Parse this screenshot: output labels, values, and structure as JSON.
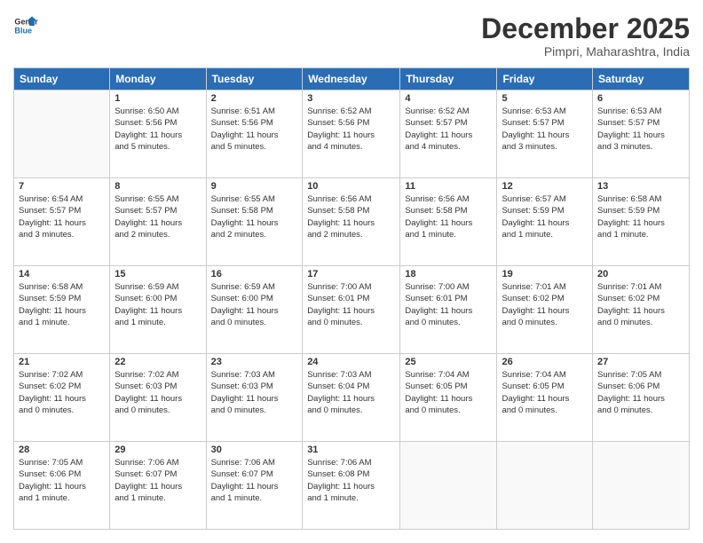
{
  "logo": {
    "general": "General",
    "blue": "Blue"
  },
  "title": "December 2025",
  "subtitle": "Pimpri, Maharashtra, India",
  "days_of_week": [
    "Sunday",
    "Monday",
    "Tuesday",
    "Wednesday",
    "Thursday",
    "Friday",
    "Saturday"
  ],
  "weeks": [
    [
      {
        "day": "",
        "info": ""
      },
      {
        "day": "1",
        "info": "Sunrise: 6:50 AM\nSunset: 5:56 PM\nDaylight: 11 hours\nand 5 minutes."
      },
      {
        "day": "2",
        "info": "Sunrise: 6:51 AM\nSunset: 5:56 PM\nDaylight: 11 hours\nand 5 minutes."
      },
      {
        "day": "3",
        "info": "Sunrise: 6:52 AM\nSunset: 5:56 PM\nDaylight: 11 hours\nand 4 minutes."
      },
      {
        "day": "4",
        "info": "Sunrise: 6:52 AM\nSunset: 5:57 PM\nDaylight: 11 hours\nand 4 minutes."
      },
      {
        "day": "5",
        "info": "Sunrise: 6:53 AM\nSunset: 5:57 PM\nDaylight: 11 hours\nand 3 minutes."
      },
      {
        "day": "6",
        "info": "Sunrise: 6:53 AM\nSunset: 5:57 PM\nDaylight: 11 hours\nand 3 minutes."
      }
    ],
    [
      {
        "day": "7",
        "info": "Sunrise: 6:54 AM\nSunset: 5:57 PM\nDaylight: 11 hours\nand 3 minutes."
      },
      {
        "day": "8",
        "info": "Sunrise: 6:55 AM\nSunset: 5:57 PM\nDaylight: 11 hours\nand 2 minutes."
      },
      {
        "day": "9",
        "info": "Sunrise: 6:55 AM\nSunset: 5:58 PM\nDaylight: 11 hours\nand 2 minutes."
      },
      {
        "day": "10",
        "info": "Sunrise: 6:56 AM\nSunset: 5:58 PM\nDaylight: 11 hours\nand 2 minutes."
      },
      {
        "day": "11",
        "info": "Sunrise: 6:56 AM\nSunset: 5:58 PM\nDaylight: 11 hours\nand 1 minute."
      },
      {
        "day": "12",
        "info": "Sunrise: 6:57 AM\nSunset: 5:59 PM\nDaylight: 11 hours\nand 1 minute."
      },
      {
        "day": "13",
        "info": "Sunrise: 6:58 AM\nSunset: 5:59 PM\nDaylight: 11 hours\nand 1 minute."
      }
    ],
    [
      {
        "day": "14",
        "info": "Sunrise: 6:58 AM\nSunset: 5:59 PM\nDaylight: 11 hours\nand 1 minute."
      },
      {
        "day": "15",
        "info": "Sunrise: 6:59 AM\nSunset: 6:00 PM\nDaylight: 11 hours\nand 1 minute."
      },
      {
        "day": "16",
        "info": "Sunrise: 6:59 AM\nSunset: 6:00 PM\nDaylight: 11 hours\nand 0 minutes."
      },
      {
        "day": "17",
        "info": "Sunrise: 7:00 AM\nSunset: 6:01 PM\nDaylight: 11 hours\nand 0 minutes."
      },
      {
        "day": "18",
        "info": "Sunrise: 7:00 AM\nSunset: 6:01 PM\nDaylight: 11 hours\nand 0 minutes."
      },
      {
        "day": "19",
        "info": "Sunrise: 7:01 AM\nSunset: 6:02 PM\nDaylight: 11 hours\nand 0 minutes."
      },
      {
        "day": "20",
        "info": "Sunrise: 7:01 AM\nSunset: 6:02 PM\nDaylight: 11 hours\nand 0 minutes."
      }
    ],
    [
      {
        "day": "21",
        "info": "Sunrise: 7:02 AM\nSunset: 6:02 PM\nDaylight: 11 hours\nand 0 minutes."
      },
      {
        "day": "22",
        "info": "Sunrise: 7:02 AM\nSunset: 6:03 PM\nDaylight: 11 hours\nand 0 minutes."
      },
      {
        "day": "23",
        "info": "Sunrise: 7:03 AM\nSunset: 6:03 PM\nDaylight: 11 hours\nand 0 minutes."
      },
      {
        "day": "24",
        "info": "Sunrise: 7:03 AM\nSunset: 6:04 PM\nDaylight: 11 hours\nand 0 minutes."
      },
      {
        "day": "25",
        "info": "Sunrise: 7:04 AM\nSunset: 6:05 PM\nDaylight: 11 hours\nand 0 minutes."
      },
      {
        "day": "26",
        "info": "Sunrise: 7:04 AM\nSunset: 6:05 PM\nDaylight: 11 hours\nand 0 minutes."
      },
      {
        "day": "27",
        "info": "Sunrise: 7:05 AM\nSunset: 6:06 PM\nDaylight: 11 hours\nand 0 minutes."
      }
    ],
    [
      {
        "day": "28",
        "info": "Sunrise: 7:05 AM\nSunset: 6:06 PM\nDaylight: 11 hours\nand 1 minute."
      },
      {
        "day": "29",
        "info": "Sunrise: 7:06 AM\nSunset: 6:07 PM\nDaylight: 11 hours\nand 1 minute."
      },
      {
        "day": "30",
        "info": "Sunrise: 7:06 AM\nSunset: 6:07 PM\nDaylight: 11 hours\nand 1 minute."
      },
      {
        "day": "31",
        "info": "Sunrise: 7:06 AM\nSunset: 6:08 PM\nDaylight: 11 hours\nand 1 minute."
      },
      {
        "day": "",
        "info": ""
      },
      {
        "day": "",
        "info": ""
      },
      {
        "day": "",
        "info": ""
      }
    ]
  ]
}
